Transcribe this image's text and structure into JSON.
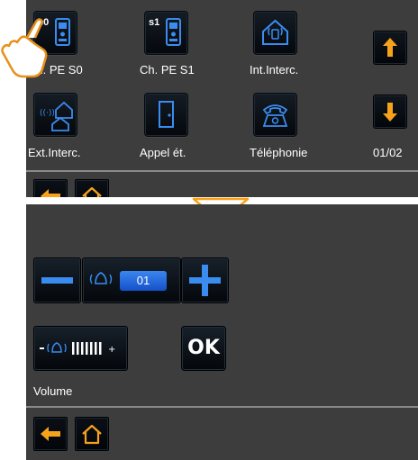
{
  "top_screen": {
    "tiles": [
      {
        "label": "Ch. PE S0",
        "badge": "s0",
        "icon": "entrance-panel-icon"
      },
      {
        "label": "Ch. PE S1",
        "badge": "s1",
        "icon": "entrance-panel-icon"
      },
      {
        "label": "Int.Interc.",
        "icon": "internal-intercom-icon"
      },
      {
        "label": "Ext.Interc.",
        "icon": "external-intercom-icon"
      },
      {
        "label": "Appel ét.",
        "icon": "floor-call-door-icon"
      },
      {
        "label": "Téléphonie",
        "icon": "telephone-icon"
      }
    ],
    "page_indicator": "01/02",
    "scroll_up_icon": "arrow-up-icon",
    "scroll_down_icon": "arrow-down-icon",
    "nav": {
      "back_icon": "arrow-left-icon",
      "home_icon": "home-icon"
    }
  },
  "bottom_screen": {
    "ring_value": "01",
    "decrease_icon": "minus-icon",
    "increase_icon": "plus-icon",
    "volume_label": "Volume",
    "ok_label": "OK",
    "nav": {
      "back_icon": "arrow-left-icon",
      "home_icon": "home-icon"
    }
  },
  "colors": {
    "accent_orange": "#f7a21b",
    "accent_blue": "#1f6fe0",
    "panel": "#3d3d3d"
  }
}
